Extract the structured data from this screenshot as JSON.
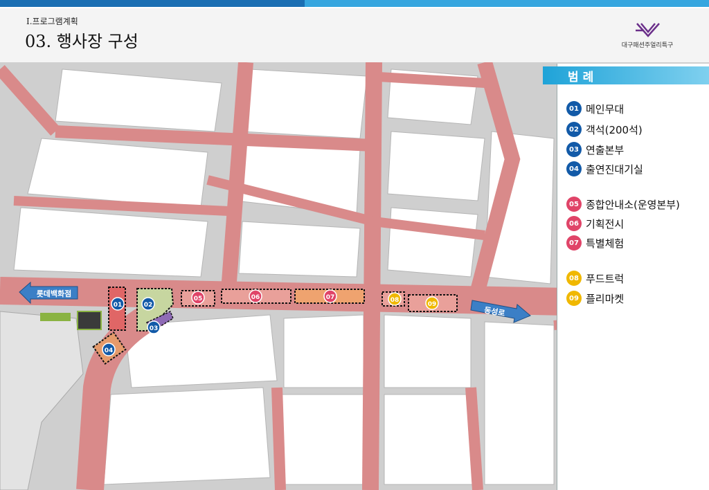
{
  "header": {
    "section": "Ⅰ.프로그램계획",
    "title": "03. 행사장 구성",
    "org_name": "대구패션주얼리특구"
  },
  "map": {
    "labels": {
      "west_arrow": "롯데백화점",
      "east_arrow": "동성로"
    },
    "markers": [
      {
        "id": "m01",
        "num": "01",
        "color": "#125aa8"
      },
      {
        "id": "m02",
        "num": "02",
        "color": "#125aa8"
      },
      {
        "id": "m03",
        "num": "03",
        "color": "#125aa8"
      },
      {
        "id": "m04",
        "num": "04",
        "color": "#125aa8"
      },
      {
        "id": "m05",
        "num": "05",
        "color": "#e04468"
      },
      {
        "id": "m06",
        "num": "06",
        "color": "#e04468"
      },
      {
        "id": "m07",
        "num": "07",
        "color": "#e04468"
      },
      {
        "id": "m08",
        "num": "08",
        "color": "#f0b800"
      },
      {
        "id": "m09",
        "num": "09",
        "color": "#f0b800"
      }
    ]
  },
  "legend": {
    "title": "범례",
    "items": [
      {
        "num": "01",
        "label": "메인무대",
        "color": "blue"
      },
      {
        "num": "02",
        "label": "객석(200석)",
        "color": "blue"
      },
      {
        "num": "03",
        "label": "연출본부",
        "color": "blue"
      },
      {
        "num": "04",
        "label": "출연진대기실",
        "color": "blue"
      },
      {
        "num": "05",
        "label": "종합안내소(운영본부)",
        "color": "red"
      },
      {
        "num": "06",
        "label": "기획전시",
        "color": "red"
      },
      {
        "num": "07",
        "label": "특별체험",
        "color": "red"
      },
      {
        "num": "08",
        "label": "푸드트럭",
        "color": "yellow"
      },
      {
        "num": "09",
        "label": "플리마켓",
        "color": "yellow"
      }
    ]
  },
  "colors": {
    "road": "#d98a8a",
    "building": "#ffffff",
    "ground": "#c9c9c9",
    "blue_marker": "#125aa8",
    "red_marker": "#e04468",
    "yellow_marker": "#f0b800",
    "arrow": "#3b7fc6"
  }
}
